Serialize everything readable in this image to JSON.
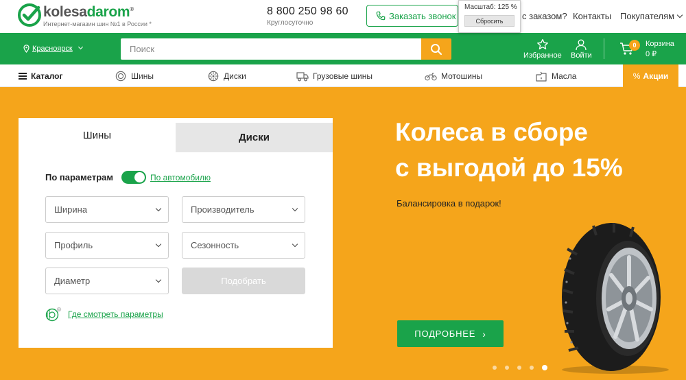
{
  "header": {
    "logo_prefix": "kolesa",
    "logo_accent": "darom",
    "logo_reg": "®",
    "tagline": "Интернет-магазин шин №1 в России *",
    "phone": "8 800 250 98 60",
    "phone_sub": "Круглосуточно",
    "callback_label": "Заказать звонок",
    "link_order_help": "с заказом?",
    "link_contacts": "Контакты",
    "link_buyers": "Покупателям"
  },
  "zoom_popup": {
    "label": "Масштаб: 125 %",
    "reset": "Сбросить"
  },
  "greenbar": {
    "city": "Красноярск",
    "search_placeholder": "Поиск",
    "favorites": "Избранное",
    "login": "Войти",
    "cart_badge": "0",
    "cart_label": "Корзина",
    "cart_total": "0 ₽"
  },
  "nav": {
    "catalog": "Каталог",
    "items": [
      "Шины",
      "Диски",
      "Грузовые шины",
      "Мотошины",
      "Масла"
    ],
    "promo": "Акции"
  },
  "search_panel": {
    "tab_tires": "Шины",
    "tab_discs": "Диски",
    "mode_label": "По параметрам",
    "mode_link": "По автомобилю",
    "width": "Ширина",
    "manufacturer": "Производитель",
    "profile": "Профиль",
    "season": "Сезонность",
    "diameter": "Диаметр",
    "submit": "Подобрать",
    "where_link": "Где смотреть параметры"
  },
  "promo": {
    "title_line1": "Колеса в сборе",
    "title_line2": "с выгодой до 15%",
    "subtitle": "Балансировка в подарок!",
    "button": "ПОДРОБНЕЕ",
    "slides_total": 5,
    "active_slide": 5
  },
  "colors": {
    "brand_green": "#1aa34a",
    "accent_orange": "#f5a51b"
  },
  "icons": [
    "logo-check-icon",
    "phone-icon",
    "location-pin-icon",
    "search-icon",
    "star-icon",
    "user-icon",
    "cart-icon",
    "menu-icon",
    "tire-icon",
    "disc-icon",
    "truck-icon",
    "moto-icon",
    "oil-icon",
    "percent-icon",
    "tire-params-icon",
    "chevron-right-icon"
  ]
}
